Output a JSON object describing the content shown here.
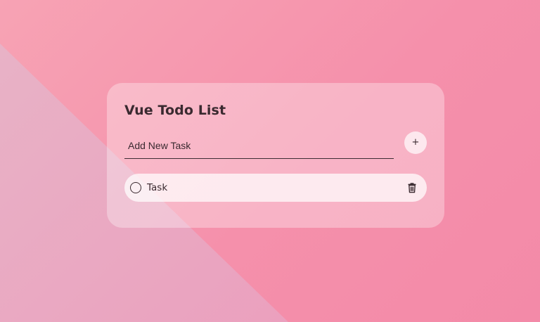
{
  "app": {
    "title": "Vue Todo List"
  },
  "new_task": {
    "placeholder": "Add New Task",
    "value": "",
    "add_label": "+"
  },
  "tasks": [
    {
      "label": "Task",
      "done": false
    }
  ],
  "icons": {
    "checkbox": "circle-outline-icon",
    "delete": "trash-icon"
  },
  "colors": {
    "background": "#f590ab",
    "background_triangle": "#e8b4c8",
    "text": "#3a2a30",
    "add_button_bg": "#fde8ee"
  }
}
